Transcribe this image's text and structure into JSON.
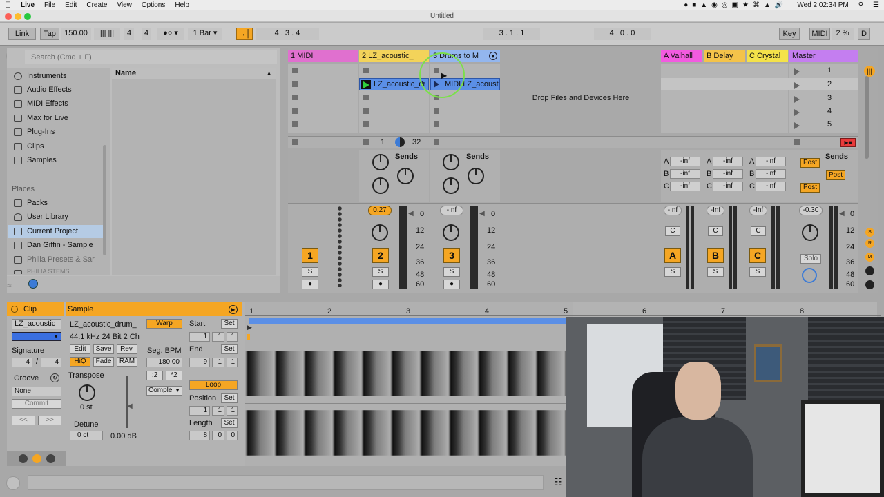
{
  "menubar": {
    "app": "Live",
    "items": [
      "File",
      "Edit",
      "Create",
      "View",
      "Options",
      "Help"
    ],
    "clock": "Wed 2:02:34 PM"
  },
  "window": {
    "title": "Untitled"
  },
  "transport": {
    "link": "Link",
    "tap": "Tap",
    "tempo": "150.00",
    "sig_num": "4",
    "sig_den": "4",
    "quant": "1 Bar",
    "arr_pos": "4 .  3 .  4",
    "punch_pos": "3 .  1 .  1",
    "loop_len": "4 .  0 .  0",
    "key": "Key",
    "midi": "MIDI",
    "cpu": "2 %",
    "d": "D"
  },
  "browser": {
    "search_placeholder": "Search (Cmd + F)",
    "categories": [
      "Instruments",
      "Audio Effects",
      "MIDI Effects",
      "Max for Live",
      "Plug-Ins",
      "Clips",
      "Samples"
    ],
    "places_header": "Places",
    "places": [
      "Packs",
      "User Library",
      "Current Project",
      "Dan Giffin - Sample",
      "Philia Presets & Sar",
      "PHILIA STEMS"
    ],
    "name_header": "Name"
  },
  "session": {
    "tracks": [
      {
        "name": "1 MIDI",
        "color": "#e46bc9",
        "num": "1"
      },
      {
        "name": "2 LZ_acoustic_",
        "color": "#f3d35a",
        "num": "2",
        "volume": "0.27",
        "clip": "LZ_acoustic_dr"
      },
      {
        "name": "3 Drums to M",
        "color": "#8fb5f0",
        "num": "3",
        "volume": "-Inf",
        "clip": "MIDI LZ_acoust"
      }
    ],
    "returns": [
      {
        "name": "A Valhall",
        "color": "#f25be0",
        "letter": "A",
        "volume": "-Inf"
      },
      {
        "name": "B Delay",
        "color": "#f4c34a",
        "letter": "B",
        "volume": "-Inf"
      },
      {
        "name": "C Crystal",
        "color": "#f4e24a",
        "letter": "C",
        "volume": "-Inf"
      }
    ],
    "master": {
      "name": "Master",
      "color": "#c47ef0",
      "volume": "-0.30",
      "scenes": [
        "1",
        "2",
        "3",
        "4",
        "5"
      ],
      "solo": "Solo"
    },
    "drop_text": "Drop Files and Devices Here",
    "sends_label": "Sends",
    "post_label": "Post",
    "inf": "-inf",
    "send_letters": [
      "A",
      "B",
      "C"
    ],
    "slice_start": "1",
    "slice_end": "32",
    "scale": [
      "0",
      "12",
      "24",
      "36",
      "48",
      "60"
    ]
  },
  "clip": {
    "header_clip": "Clip",
    "header_sample": "Sample",
    "name": "LZ_acoustic",
    "signature_label": "Signature",
    "sig_num": "4",
    "sig_den": "4",
    "groove_label": "Groove",
    "groove_value": "None",
    "commit": "Commit",
    "sample_name": "LZ_acoustic_drum_",
    "sample_info": "44.1 kHz 24 Bit 2 Ch",
    "edit": "Edit",
    "save": "Save",
    "rev": "Rev.",
    "hiq": "HiQ",
    "fade": "Fade",
    "ram": "RAM",
    "transpose_label": "Transpose",
    "transpose_value": "0 st",
    "detune_label": "Detune",
    "detune_value": "0 ct",
    "gain_value": "0.00 dB",
    "warp": "Warp",
    "seg_bpm_label": "Seg. BPM",
    "seg_bpm": "180.00",
    "half": ":2",
    "double": "*2",
    "mode": "Comple",
    "start_label": "Start",
    "end_label": "End",
    "set": "Set",
    "loop": "Loop",
    "position_label": "Position",
    "length_label": "Length",
    "start_vals": [
      "1",
      "1",
      "1"
    ],
    "end_vals": [
      "9",
      "1",
      "1"
    ],
    "position_vals": [
      "1",
      "1",
      "1"
    ],
    "length_vals": [
      "8",
      "0",
      "0"
    ],
    "ruler": [
      "1",
      "2",
      "3",
      "4",
      "5",
      "6",
      "7",
      "8"
    ]
  },
  "colors": {
    "accent": "#f5a623",
    "clip_blue": "#5b8fe6",
    "play_green": "#2fd13c"
  }
}
